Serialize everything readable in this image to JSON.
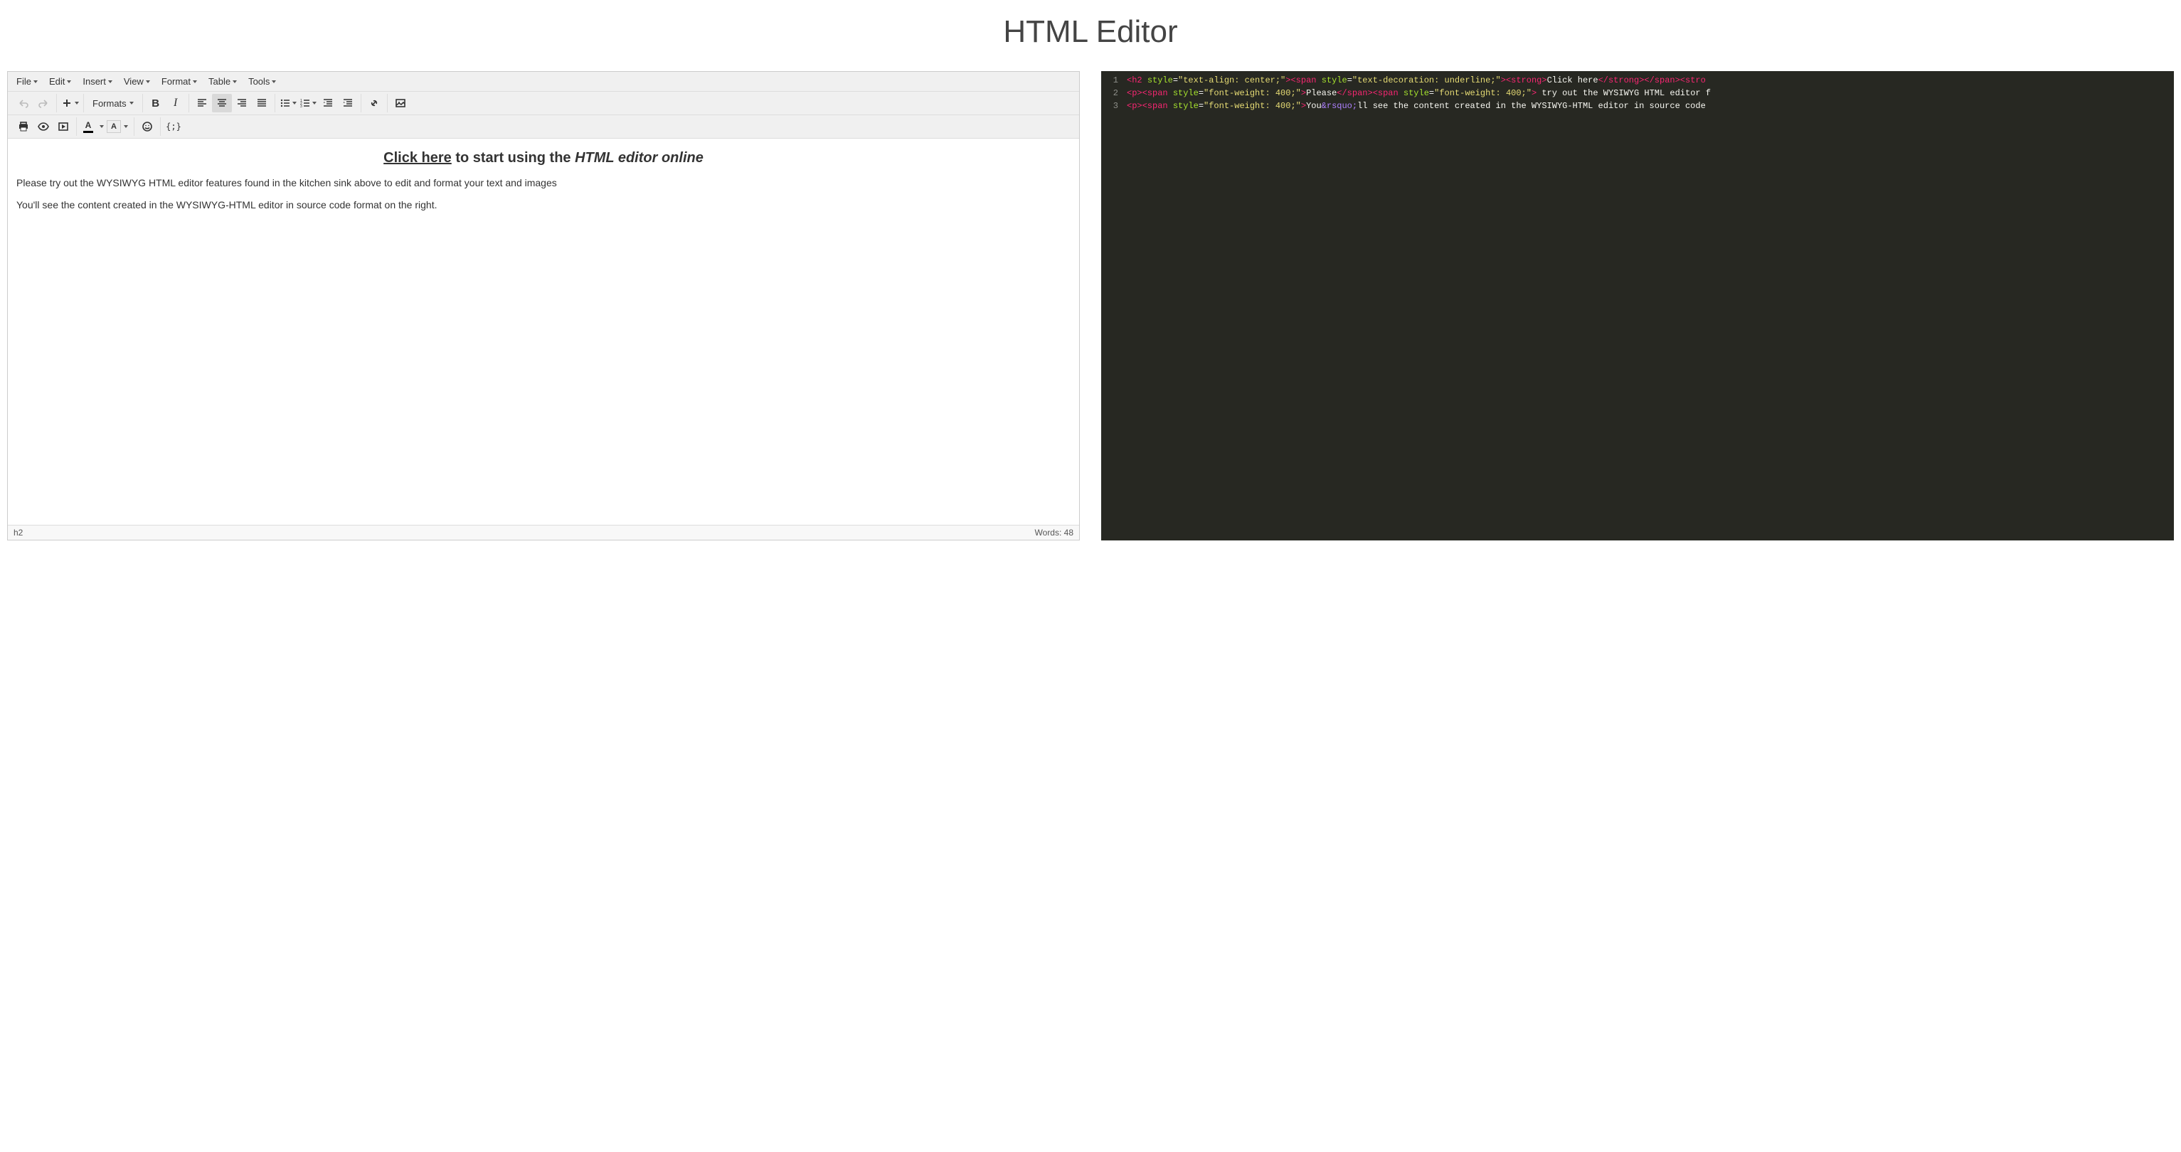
{
  "page_title": "HTML Editor",
  "menubar": [
    "File",
    "Edit",
    "Insert",
    "View",
    "Format",
    "Table",
    "Tools"
  ],
  "toolbar": {
    "formats_label": "Formats"
  },
  "content": {
    "heading_link": "Click here",
    "heading_middle": " to start using the ",
    "heading_em": "HTML editor online",
    "para1": "Please try out the WYSIWYG HTML editor features found in the kitchen sink above to edit and format your text and images",
    "para2": "You'll see the content created in the WYSIWYG-HTML editor in source code format on the right."
  },
  "statusbar": {
    "path": "h2",
    "words": "Words: 48"
  },
  "code": {
    "lines": [
      {
        "n": "1",
        "tokens": [
          {
            "t": "tag",
            "v": "<h2 "
          },
          {
            "t": "attr",
            "v": "style"
          },
          {
            "t": "op",
            "v": "="
          },
          {
            "t": "str",
            "v": "\"text-align: center;\""
          },
          {
            "t": "tag",
            "v": "><span "
          },
          {
            "t": "attr",
            "v": "style"
          },
          {
            "t": "op",
            "v": "="
          },
          {
            "t": "str",
            "v": "\"text-decoration: underline;\""
          },
          {
            "t": "tag",
            "v": "><strong>"
          },
          {
            "t": "txt",
            "v": "Click here"
          },
          {
            "t": "tag",
            "v": "</strong></span><stro"
          }
        ]
      },
      {
        "n": "2",
        "tokens": [
          {
            "t": "tag",
            "v": "<p><span "
          },
          {
            "t": "attr",
            "v": "style"
          },
          {
            "t": "op",
            "v": "="
          },
          {
            "t": "str",
            "v": "\"font-weight: 400;\""
          },
          {
            "t": "tag",
            "v": ">"
          },
          {
            "t": "txt",
            "v": "Please"
          },
          {
            "t": "tag",
            "v": "</span><span "
          },
          {
            "t": "attr",
            "v": "style"
          },
          {
            "t": "op",
            "v": "="
          },
          {
            "t": "str",
            "v": "\"font-weight: 400;\""
          },
          {
            "t": "tag",
            "v": ">"
          },
          {
            "t": "txt",
            "v": " try out the WYSIWYG HTML editor f"
          }
        ]
      },
      {
        "n": "3",
        "tokens": [
          {
            "t": "tag",
            "v": "<p><span "
          },
          {
            "t": "attr",
            "v": "style"
          },
          {
            "t": "op",
            "v": "="
          },
          {
            "t": "str",
            "v": "\"font-weight: 400;\""
          },
          {
            "t": "tag",
            "v": ">"
          },
          {
            "t": "txt",
            "v": "You"
          },
          {
            "t": "amp",
            "v": "&rsquo;"
          },
          {
            "t": "txt",
            "v": "ll see the content created in the WYSIWYG-HTML editor in source code "
          }
        ]
      }
    ]
  }
}
